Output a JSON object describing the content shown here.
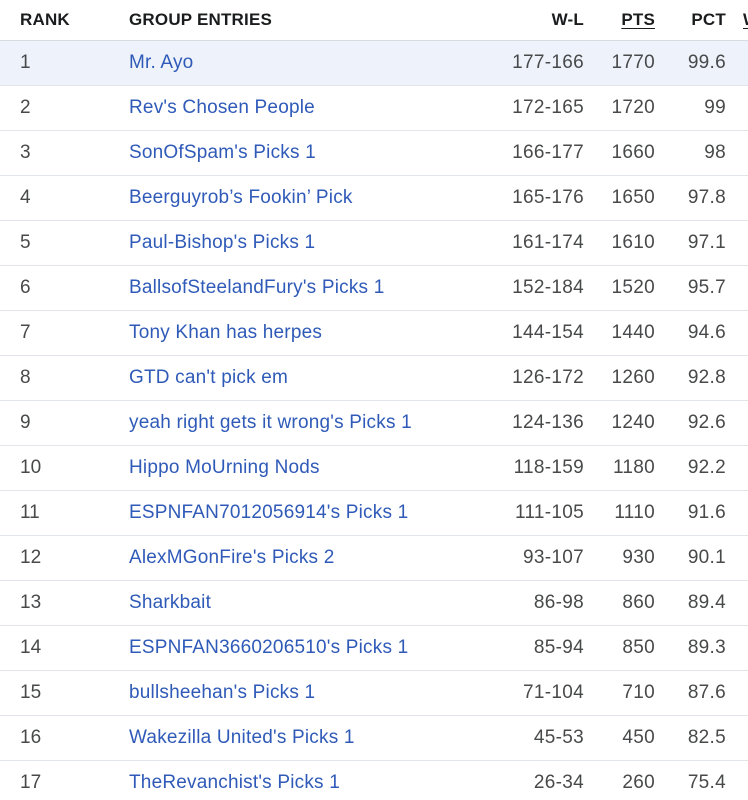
{
  "header": {
    "rank": "RANK",
    "entries": "GROUP ENTRIES",
    "wl": "W-L",
    "pts": "PTS",
    "pct": "PCT",
    "extra": "W"
  },
  "rows": [
    {
      "rank": "1",
      "name": "Mr. Ayo",
      "wl": "177-166",
      "pts": "1770",
      "pct": "99.6"
    },
    {
      "rank": "2",
      "name": "Rev's Chosen People",
      "wl": "172-165",
      "pts": "1720",
      "pct": "99"
    },
    {
      "rank": "3",
      "name": "SonOfSpam's Picks 1",
      "wl": "166-177",
      "pts": "1660",
      "pct": "98"
    },
    {
      "rank": "4",
      "name": "Beerguyrob’s Fookin’ Pick",
      "wl": "165-176",
      "pts": "1650",
      "pct": "97.8"
    },
    {
      "rank": "5",
      "name": "Paul-Bishop's Picks 1",
      "wl": "161-174",
      "pts": "1610",
      "pct": "97.1"
    },
    {
      "rank": "6",
      "name": "BallsofSteelandFury's Picks 1",
      "wl": "152-184",
      "pts": "1520",
      "pct": "95.7"
    },
    {
      "rank": "7",
      "name": "Tony Khan has herpes",
      "wl": "144-154",
      "pts": "1440",
      "pct": "94.6"
    },
    {
      "rank": "8",
      "name": "GTD can't pick em",
      "wl": "126-172",
      "pts": "1260",
      "pct": "92.8"
    },
    {
      "rank": "9",
      "name": "yeah right gets it wrong's Picks 1",
      "wl": "124-136",
      "pts": "1240",
      "pct": "92.6"
    },
    {
      "rank": "10",
      "name": "Hippo MoUrning Nods",
      "wl": "118-159",
      "pts": "1180",
      "pct": "92.2"
    },
    {
      "rank": "11",
      "name": "ESPNFAN7012056914's Picks 1",
      "wl": "111-105",
      "pts": "1110",
      "pct": "91.6"
    },
    {
      "rank": "12",
      "name": "AlexMGonFire's Picks 2",
      "wl": "93-107",
      "pts": "930",
      "pct": "90.1"
    },
    {
      "rank": "13",
      "name": "Sharkbait",
      "wl": "86-98",
      "pts": "860",
      "pct": "89.4"
    },
    {
      "rank": "14",
      "name": "ESPNFAN3660206510's Picks 1",
      "wl": "85-94",
      "pts": "850",
      "pct": "89.3"
    },
    {
      "rank": "15",
      "name": "bullsheehan's Picks 1",
      "wl": "71-104",
      "pts": "710",
      "pct": "87.6"
    },
    {
      "rank": "16",
      "name": "Wakezilla United's Picks 1",
      "wl": "45-53",
      "pts": "450",
      "pct": "82.5"
    },
    {
      "rank": "17",
      "name": "TheRevanchist's Picks 1",
      "wl": "26-34",
      "pts": "260",
      "pct": "75.4"
    }
  ],
  "highlight_row": 1,
  "colors": {
    "link": "#2f5ab8",
    "highlight_bg": "#eef3fb",
    "divider": "#e1e4e8"
  }
}
